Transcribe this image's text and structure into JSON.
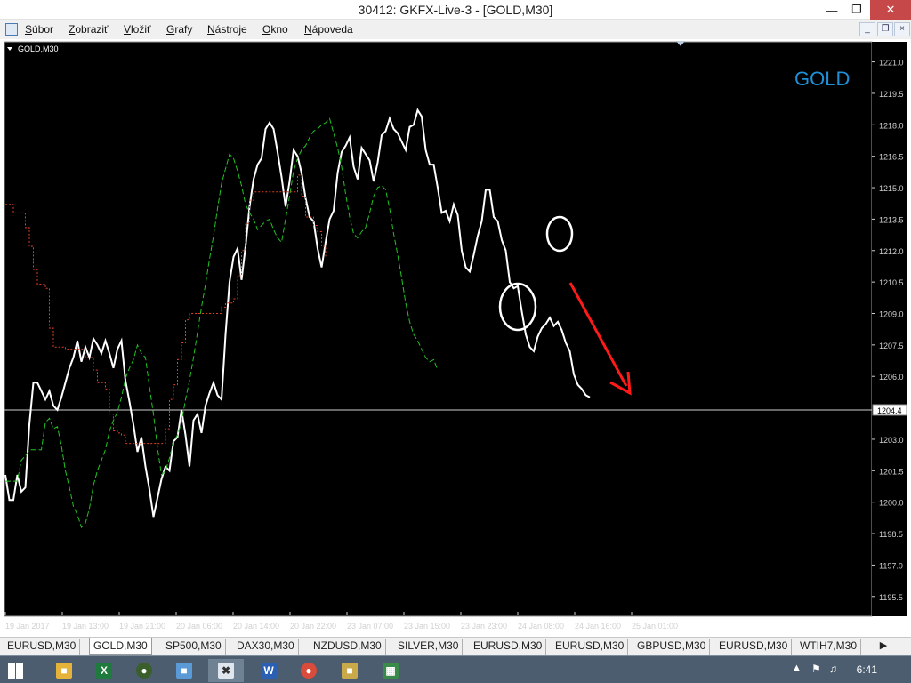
{
  "window": {
    "title": "30412: GKFX-Live-3 - [GOLD,M30]"
  },
  "menu": [
    "Súbor",
    "Zobraziť",
    "Vložiť",
    "Grafy",
    "Nástroje",
    "Okno",
    "Nápoveda"
  ],
  "chart": {
    "symbol_label": "GOLD,M30",
    "watermark": "GOLD",
    "current_price": "1204.4",
    "y_ticks": [
      "1221.0",
      "1219.5",
      "1218.0",
      "1216.5",
      "1215.0",
      "1213.5",
      "1212.0",
      "1210.5",
      "1209.0",
      "1207.5",
      "1206.0",
      "1203.0",
      "1201.5",
      "1200.0",
      "1198.5",
      "1197.0",
      "1195.5"
    ],
    "x_ticks": [
      "19 Jan 2017",
      "19 Jan 13:00",
      "19 Jan 21:00",
      "20 Jan 06:00",
      "20 Jan 14:00",
      "20 Jan 22:00",
      "23 Jan 07:00",
      "23 Jan 15:00",
      "23 Jan 23:00",
      "24 Jan 08:00",
      "24 Jan 16:00",
      "25 Jan 01:00"
    ],
    "colors": {
      "background": "#000000",
      "price": "#ffffff",
      "lagging": "#22c322",
      "base": "#e04020",
      "arrow": "#ff1a1a",
      "watermark": "#1e90d8",
      "axis": "#d0d0d0"
    }
  },
  "chart_data": {
    "type": "line",
    "title": "",
    "xlabel": "",
    "ylabel": "",
    "ylim": [
      1194.6,
      1222.0
    ],
    "series": [
      {
        "values": [
          1201.3,
          1200.1,
          1200.1,
          1201.3,
          1200.5,
          1200.7,
          1203.7,
          1205.7,
          1205.7,
          1205.3,
          1204.9,
          1205.3,
          1204.6,
          1204.4,
          1205.0,
          1205.7,
          1206.4,
          1206.9,
          1207.7,
          1206.7,
          1207.4,
          1206.9,
          1207.8,
          1207.5,
          1207.1,
          1207.7,
          1207.1,
          1206.4,
          1207.3,
          1207.7,
          1205.8,
          1204.8,
          1203.7,
          1202.4,
          1203.1,
          1201.7,
          1200.6,
          1199.3,
          1200.2,
          1201.1,
          1201.7,
          1201.5,
          1202.9,
          1203.1,
          1204.4,
          1203.2,
          1201.7,
          1203.9,
          1204.2,
          1203.3,
          1204.6,
          1205.2,
          1205.7,
          1205.1,
          1204.9,
          1208.0,
          1210.5,
          1211.7,
          1212.1,
          1210.6,
          1212.2,
          1214.1,
          1215.4,
          1216.1,
          1216.4,
          1217.8,
          1218.1,
          1217.8,
          1216.7,
          1215.5,
          1214.1,
          1215.3,
          1216.8,
          1216.5,
          1215.7,
          1214.5,
          1213.6,
          1213.4,
          1212.1,
          1211.2,
          1212.4,
          1213.5,
          1213.9,
          1215.7,
          1216.7,
          1217.0,
          1217.4,
          1216.0,
          1215.4,
          1216.9,
          1216.6,
          1216.3,
          1215.3,
          1216.2,
          1217.5,
          1217.7,
          1218.3,
          1217.8,
          1217.6,
          1217.2,
          1216.8,
          1217.9,
          1218.0,
          1218.7,
          1218.4,
          1216.8,
          1216.1,
          1216.1,
          1215.0,
          1213.8,
          1213.9,
          1213.4,
          1214.2,
          1213.7,
          1212.0,
          1211.2,
          1211.0,
          1211.8,
          1212.7,
          1213.4,
          1214.9,
          1214.9,
          1213.6,
          1213.4,
          1212.5,
          1212.0,
          1210.5,
          1210.2,
          1210.3,
          1209.1,
          1208.0,
          1207.4,
          1207.2,
          1207.9,
          1208.3,
          1208.5,
          1208.8,
          1208.4,
          1208.6,
          1208.2,
          1207.6,
          1207.2,
          1206.1,
          1205.6,
          1205.4,
          1205.1,
          1205.0
        ],
        "x_start": 0
      },
      {
        "values": [
          1201.0,
          1201.0,
          1201.0,
          1201.0,
          1202.0,
          1202.2,
          1202.5,
          1202.5,
          1202.5,
          1202.5,
          1203.8,
          1204.0,
          1203.5,
          1203.6,
          1202.7,
          1201.5,
          1200.7,
          1199.8,
          1199.4,
          1198.8,
          1199.0,
          1199.7,
          1200.8,
          1201.5,
          1202.0,
          1202.5,
          1203.4,
          1203.9,
          1204.3,
          1205.0,
          1205.9,
          1206.4,
          1206.8,
          1207.5,
          1207.1,
          1206.9,
          1205.5,
          1204.2,
          1202.6,
          1201.3,
          1201.5,
          1202.1,
          1202.9,
          1203.2,
          1203.8,
          1204.9,
          1205.8,
          1206.9,
          1208.1,
          1209.3,
          1210.4,
          1211.6,
          1212.7,
          1214.0,
          1215.2,
          1215.9,
          1216.6,
          1216.4,
          1215.8,
          1215.1,
          1214.2,
          1213.8,
          1213.5,
          1213.0,
          1213.2,
          1213.4,
          1213.5,
          1213.0,
          1212.6,
          1212.4,
          1213.5,
          1214.6,
          1215.8,
          1216.4,
          1216.8,
          1217.0,
          1217.4,
          1217.7,
          1217.8,
          1218.0,
          1218.1,
          1218.3,
          1217.6,
          1216.9,
          1216.0,
          1214.7,
          1213.6,
          1212.8,
          1212.6,
          1212.9,
          1213.1,
          1213.8,
          1214.6,
          1215.0,
          1215.1,
          1214.9,
          1214.0,
          1212.8,
          1211.8,
          1210.7,
          1209.5,
          1208.6,
          1208.0,
          1207.7,
          1207.3,
          1206.9,
          1206.7,
          1206.8,
          1206.3
        ],
        "x_start": 0
      },
      {
        "values": [
          1214.2,
          1214.2,
          1213.8,
          1213.8,
          1213.8,
          1213.1,
          1212.2,
          1211.1,
          1210.4,
          1210.4,
          1210.2,
          1208.3,
          1207.4,
          1207.4,
          1207.4,
          1207.3,
          1207.3,
          1207.3,
          1207.3,
          1207.3,
          1206.9,
          1206.9,
          1206.3,
          1205.7,
          1205.7,
          1205.4,
          1204.2,
          1203.4,
          1203.3,
          1203.2,
          1202.8,
          1202.8,
          1202.8,
          1202.8,
          1202.8,
          1202.8,
          1202.8,
          1202.8,
          1202.8,
          1202.8,
          1203.5,
          1204.9,
          1205.6,
          1206.8,
          1207.6,
          1208.7,
          1209.0,
          1209.0,
          1209.0,
          1209.0,
          1209.0,
          1209.0,
          1209.0,
          1209.0,
          1209.3,
          1209.5,
          1209.5,
          1209.7,
          1210.8,
          1212.0,
          1213.3,
          1214.4,
          1214.8,
          1214.8,
          1214.8,
          1214.8,
          1214.8,
          1214.8,
          1214.8,
          1214.8,
          1214.8,
          1214.8,
          1214.8,
          1215.6,
          1214.6,
          1213.6,
          1213.6,
          1213.2,
          1212.9,
          1212.2,
          1211.7
        ],
        "x_start": 0
      }
    ]
  },
  "tabs": [
    "EURUSD,M30",
    "GOLD,M30",
    "SP500,M30",
    "DAX30,M30",
    "NZDUSD,M30",
    "SILVER,M30",
    "EURUSD,M30",
    "EURUSD,M30",
    "GBPUSD,M30",
    "EURUSD,M30",
    "WTIH7,M30"
  ],
  "active_tab": 1,
  "taskbar": {
    "apps": [
      "File Explorer",
      "Excel",
      "Chrome",
      "Folder",
      "MetaTrader",
      "Word",
      "Chrome",
      "Files",
      "Calculator"
    ],
    "clock": "6:41"
  }
}
